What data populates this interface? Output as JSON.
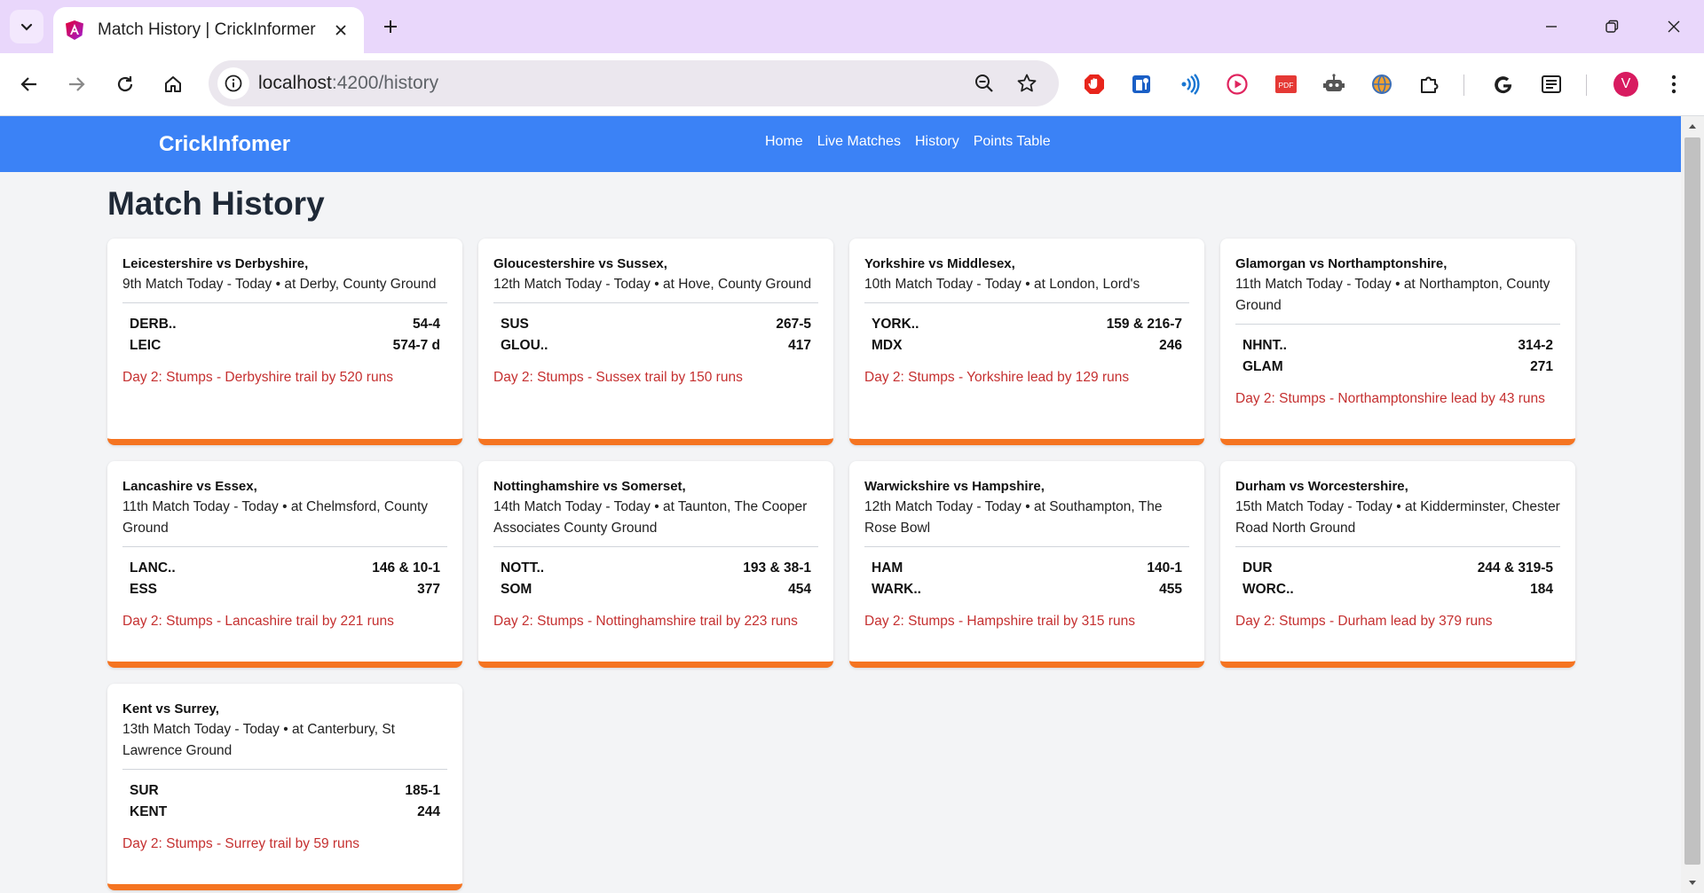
{
  "browser": {
    "tab_title": "Match History | CrickInformer",
    "url_host": "localhost",
    "url_path": ":4200/history",
    "profile_initial": "V"
  },
  "app": {
    "brand": "CrickInfomer",
    "nav": [
      "Home",
      "Live Matches",
      "History",
      "Points Table"
    ],
    "page_title": "Match History"
  },
  "colors": {
    "nav_bg": "#3b82f6",
    "card_accent": "#f57421",
    "status_text": "#c53030",
    "tabbar": "#e9d7fb"
  },
  "matches": [
    {
      "title": "Leicestershire vs Derbyshire,",
      "subtitle": "9th Match Today - Today • at Derby, County Ground",
      "team1": "DERB..",
      "score1": "54-4",
      "team2": "LEIC",
      "score2": "574-7 d",
      "status": "Day 2: Stumps - Derbyshire trail by 520 runs"
    },
    {
      "title": "Gloucestershire vs Sussex,",
      "subtitle": "12th Match Today - Today • at Hove, County Ground",
      "team1": "SUS",
      "score1": "267-5",
      "team2": "GLOU..",
      "score2": "417",
      "status": "Day 2: Stumps - Sussex trail by 150 runs"
    },
    {
      "title": "Yorkshire vs Middlesex,",
      "subtitle": "10th Match Today - Today • at London, Lord's",
      "team1": "YORK..",
      "score1": "159 & 216-7",
      "team2": "MDX",
      "score2": "246",
      "status": "Day 2: Stumps - Yorkshire lead by 129 runs"
    },
    {
      "title": "Glamorgan vs Northamptonshire,",
      "subtitle": "11th Match Today - Today • at Northampton, County Ground",
      "team1": "NHNT..",
      "score1": "314-2",
      "team2": "GLAM",
      "score2": "271",
      "status": "Day 2: Stumps - Northamptonshire lead by 43 runs"
    },
    {
      "title": "Lancashire vs Essex,",
      "subtitle": "11th Match Today - Today • at Chelmsford, County Ground",
      "team1": "LANC..",
      "score1": "146 & 10-1",
      "team2": "ESS",
      "score2": "377",
      "status": "Day 2: Stumps - Lancashire trail by 221 runs"
    },
    {
      "title": "Nottinghamshire vs Somerset,",
      "subtitle": "14th Match Today - Today • at Taunton, The Cooper Associates County Ground",
      "team1": "NOTT..",
      "score1": "193 & 38-1",
      "team2": "SOM",
      "score2": "454",
      "status": "Day 2: Stumps - Nottinghamshire trail by 223 runs"
    },
    {
      "title": "Warwickshire vs Hampshire,",
      "subtitle": "12th Match Today - Today • at Southampton, The Rose Bowl",
      "team1": "HAM",
      "score1": "140-1",
      "team2": "WARK..",
      "score2": "455",
      "status": "Day 2: Stumps - Hampshire trail by 315 runs"
    },
    {
      "title": "Durham vs Worcestershire,",
      "subtitle": "15th Match Today - Today • at Kidderminster, Chester Road North Ground",
      "team1": "DUR",
      "score1": "244 & 319-5",
      "team2": "WORC..",
      "score2": "184",
      "status": "Day 2: Stumps - Durham lead by 379 runs"
    },
    {
      "title": "Kent vs Surrey,",
      "subtitle": "13th Match Today - Today • at Canterbury, St Lawrence Ground",
      "team1": "SUR",
      "score1": "185-1",
      "team2": "KENT",
      "score2": "244",
      "status": "Day 2: Stumps - Surrey trail by 59 runs"
    }
  ]
}
